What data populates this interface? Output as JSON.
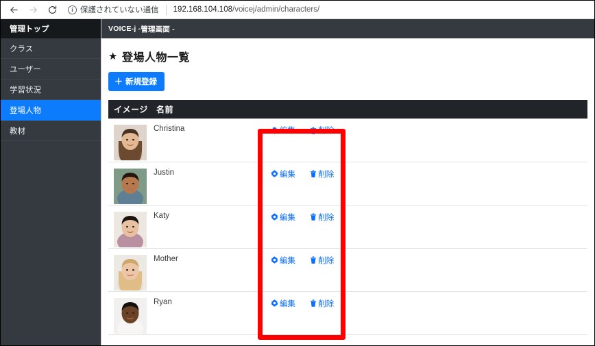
{
  "browser": {
    "back_icon": "back-arrow-icon",
    "forward_icon": "forward-arrow-icon",
    "reload_icon": "reload-icon",
    "info_icon": "info-circle-icon",
    "security_text": "保護されていない通信",
    "url_host": "192.168.104.108",
    "url_path": "/voicej/admin/characters/",
    "url_full": "192.168.104.108/voicej/admin/characters/"
  },
  "sidebar": {
    "brand": "管理トップ",
    "items": [
      {
        "label": "クラス",
        "active": false
      },
      {
        "label": "ユーザー",
        "active": false
      },
      {
        "label": "学習状況",
        "active": false
      },
      {
        "label": "登場人物",
        "active": true
      },
      {
        "label": "教材",
        "active": false
      }
    ]
  },
  "topbar": {
    "brand_main": "VOICE-j - ",
    "brand_sub": "管理画面 -",
    "full": "VOICE-j - 管理画面 -"
  },
  "main": {
    "star_glyph": "★",
    "title": "登場人物一覧",
    "new_button": {
      "plus": "＋",
      "label": "新規登録"
    },
    "table": {
      "headers": {
        "image": "イメージ",
        "name": "名前",
        "ops": ""
      },
      "edit_label": "編集",
      "delete_label": "削除",
      "edit_icon": "gear-icon",
      "delete_icon": "trash-icon",
      "rows": [
        {
          "name": "Christina",
          "avatar": "christina-photo"
        },
        {
          "name": "Justin",
          "avatar": "justin-photo"
        },
        {
          "name": "Katy",
          "avatar": "katy-photo"
        },
        {
          "name": "Mother",
          "avatar": "mother-photo"
        },
        {
          "name": "Ryan",
          "avatar": "ryan-photo"
        }
      ]
    }
  },
  "annotation": {
    "shape": "rectangle",
    "color": "#fe0000",
    "target": "operation-column-edit-delete-links"
  },
  "colors": {
    "sidebar_bg": "#343a40",
    "sidebar_brand_bg": "#16191c",
    "accent_blue": "#0c7cfd",
    "table_header_bg": "#212529",
    "link_blue": "#0d6efd",
    "annotation_red": "#fe0000"
  }
}
